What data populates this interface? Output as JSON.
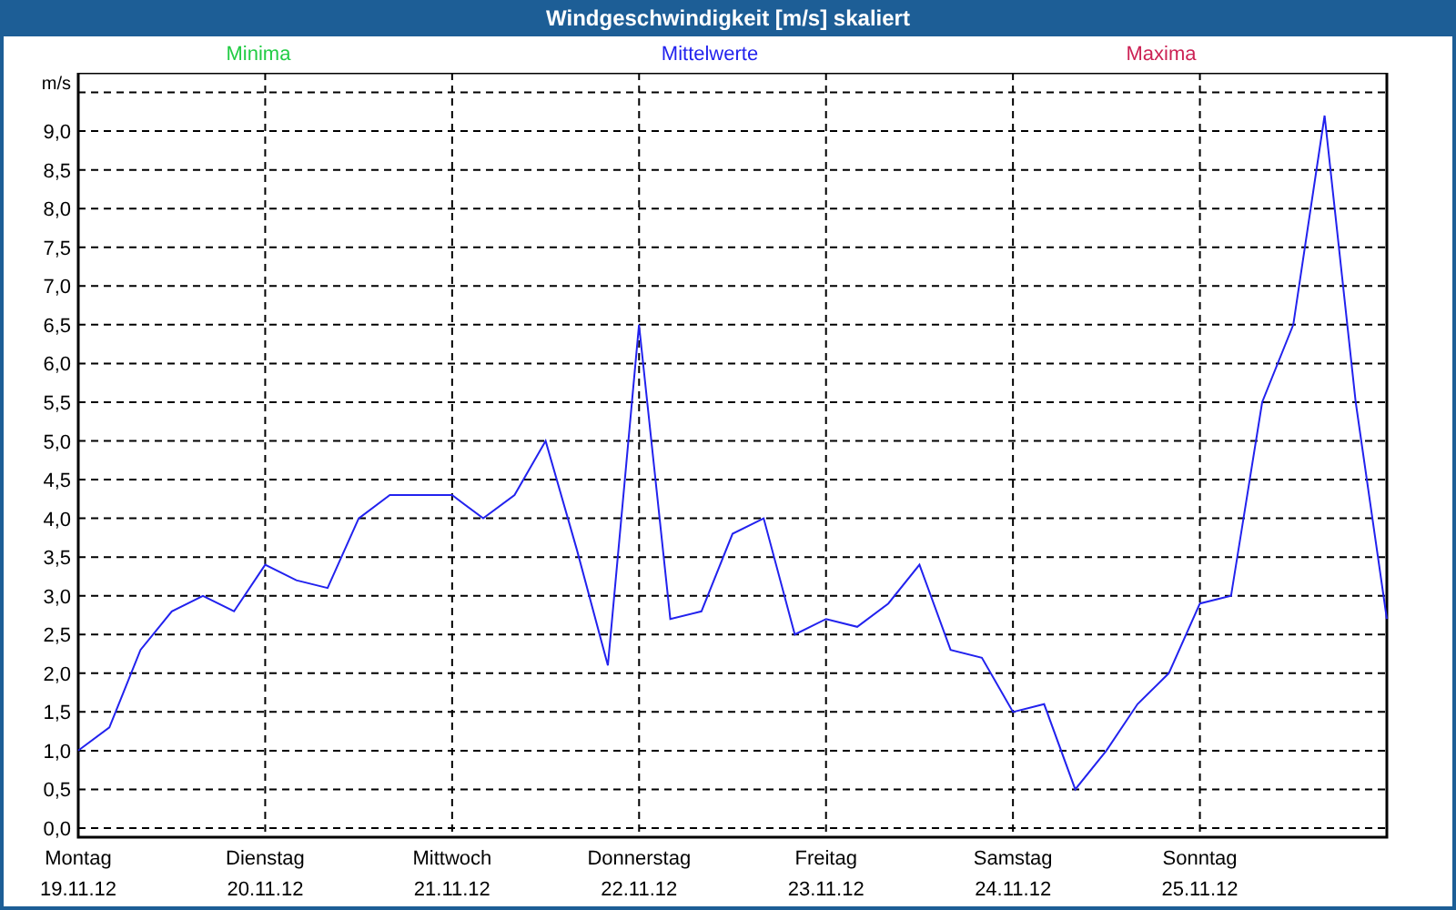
{
  "window": {
    "title": "Windgeschwindigkeit [m/s] skaliert"
  },
  "legend": [
    {
      "label": "Minima",
      "color": "#22cc44"
    },
    {
      "label": "Maxima",
      "color": "#cc2255"
    }
  ],
  "chart": {
    "chart_data": {
      "type": "line",
      "grid": true,
      "ylabel": "m/s",
      "ylim": [
        0,
        9.5
      ],
      "yticks": [
        {
          "value": 0,
          "label": "0,0"
        },
        {
          "value": 0.5,
          "label": "0,5"
        },
        {
          "value": 1,
          "label": "1,0"
        },
        {
          "value": 1.5,
          "label": "1,5"
        },
        {
          "value": 2,
          "label": "2,0"
        },
        {
          "value": 2.5,
          "label": "2,5"
        },
        {
          "value": 3,
          "label": "3,0"
        },
        {
          "value": 3.5,
          "label": "3,5"
        },
        {
          "value": 4,
          "label": "4,0"
        },
        {
          "value": 4.5,
          "label": "4,5"
        },
        {
          "value": 5,
          "label": "5,0"
        },
        {
          "value": 5.5,
          "label": "5,5"
        },
        {
          "value": 6,
          "label": "6,0"
        },
        {
          "value": 6.5,
          "label": "6,5"
        },
        {
          "value": 7,
          "label": "7,0"
        },
        {
          "value": 7.5,
          "label": "7,5"
        },
        {
          "value": 8,
          "label": "8,0"
        },
        {
          "value": 8.5,
          "label": "8,5"
        },
        {
          "value": 9,
          "label": "9,0"
        }
      ],
      "categories": [
        "Montag",
        null,
        null,
        null,
        null,
        null,
        "Dienstag",
        null,
        null,
        null,
        null,
        null,
        "Mittwoch",
        null,
        null,
        null,
        null,
        null,
        "Donnerstag",
        null,
        null,
        null,
        null,
        null,
        "Freitag",
        null,
        null,
        null,
        null,
        null,
        "Samstag",
        null,
        null,
        null,
        null,
        null,
        "Sonntag",
        null,
        null,
        null,
        null,
        null,
        null
      ],
      "series": [
        {
          "name": "Mittelwerte",
          "color": "#2222ee",
          "values": [
            1.0,
            1.3,
            2.3,
            2.8,
            3.0,
            2.8,
            3.4,
            3.2,
            3.1,
            4.0,
            4.3,
            4.3,
            4.3,
            4.0,
            4.3,
            5.0,
            3.6,
            2.1,
            6.5,
            2.7,
            2.8,
            3.8,
            4.0,
            2.5,
            2.7,
            2.6,
            2.9,
            3.4,
            2.3,
            2.2,
            1.5,
            1.6,
            0.5,
            1.0,
            1.6,
            2.0,
            2.9,
            3.0,
            5.5,
            6.5,
            9.2,
            5.5,
            2.7
          ]
        }
      ]
    },
    "dates": [
      "19.11.12",
      "20.11.12",
      "21.11.12",
      "22.11.12",
      "23.11.12",
      "24.11.12",
      "25.11.12"
    ]
  }
}
